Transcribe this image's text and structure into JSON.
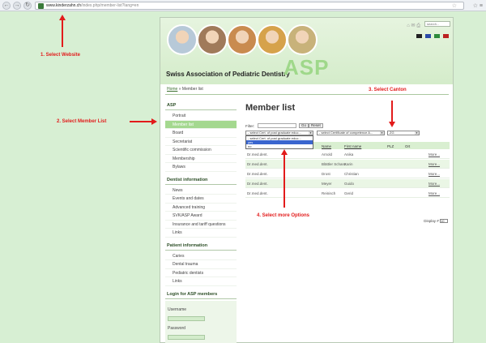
{
  "browser": {
    "url_host": "www.kinderzahn.ch",
    "url_path": "/index.php/member-list?lang=en",
    "back": "←",
    "forward": "→",
    "star": "☆",
    "menu": "☆ ≡"
  },
  "annotations": {
    "step1": "1. Select Website",
    "step2": "2. Select Member List",
    "step3": "3. Select Canton",
    "step4": "4. Select more Options"
  },
  "site": {
    "title": "Swiss Association of Pediatric Dentistry",
    "logo": "ASP",
    "search_placeholder": "search...",
    "top_icons": "⌂ ✉ ⎙",
    "photo_colors": [
      "#b7c9d8",
      "#a07a5a",
      "#c98b4f",
      "#d6a24b",
      "#c8b27a"
    ],
    "flags": [
      {
        "name": "german-flag-icon",
        "color": "#222"
      },
      {
        "name": "french-flag-icon",
        "color": "#2a4aa8"
      },
      {
        "name": "italian-flag-icon",
        "color": "#2e8b3c"
      },
      {
        "name": "english-flag-icon",
        "color": "#b22"
      }
    ]
  },
  "breadcrumb": {
    "home": "Home",
    "separator": " » ",
    "current": "Member list"
  },
  "sidebar": {
    "asp_heading": "ASP",
    "asp_items": [
      "Portrait",
      "Member list",
      "Board",
      "Secretariat",
      "Scientific commission",
      "Membership",
      "Bylaws"
    ],
    "dentist_heading": "Dentist information",
    "dentist_items": [
      "News",
      "Events and dates",
      "Advanced training",
      "SVK/ASP Award",
      "Insurance and tariff questions",
      "Links"
    ],
    "patient_heading": "Patient information",
    "patient_items": [
      "Caries",
      "Dental trauma",
      "Pediatric dentists",
      "Links"
    ],
    "login_heading": "Login for ASP members",
    "username_label": "Username",
    "password_label": "Password"
  },
  "main": {
    "title": "Member list",
    "filter_label": "Filter:",
    "go_label": "Go",
    "reset_label": "Reset",
    "select_cert_postgrad": "- select Cert. of post graduate educ...",
    "select_cert_competence": "- select Certificate of competence A...",
    "select_canton": "ZG",
    "dropdown_options": [
      "- select Cert. of post graduate educ...",
      "yes",
      "no"
    ],
    "columns": {
      "title": "",
      "name": "Name",
      "first_name": "First name",
      "plz": "PLZ",
      "ort": "Ort"
    },
    "rows": [
      {
        "title": "Dr.med.dent.",
        "name": "Arnold",
        "first_name": "Anika",
        "more": "More..."
      },
      {
        "title": "Dr.med.dent.",
        "name": "Blättler Schanz",
        "first_name": "Karin",
        "more": "More..."
      },
      {
        "title": "Dr.med.dent.",
        "name": "Drost",
        "first_name": "Christian",
        "more": "More..."
      },
      {
        "title": "Dr.med.dent.",
        "name": "Meyer",
        "first_name": "Guido",
        "more": "More..."
      },
      {
        "title": "Dr.med.dent.",
        "name": "Reinisch",
        "first_name": "Gerid",
        "more": "More..."
      }
    ],
    "display_label": "Display #",
    "display_value": "10"
  }
}
